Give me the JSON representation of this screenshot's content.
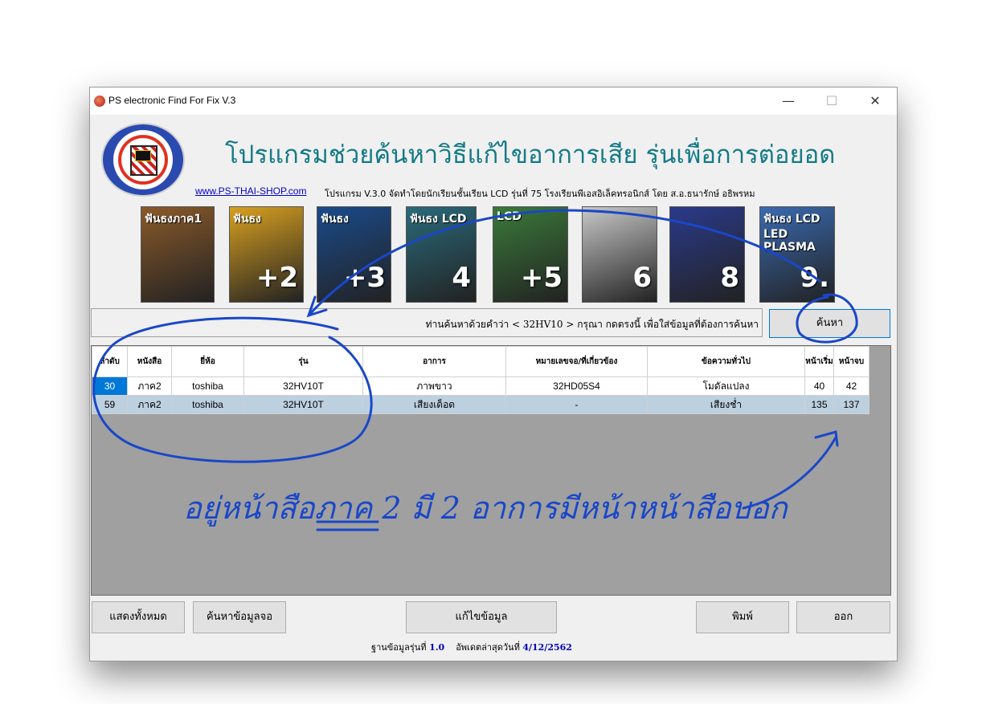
{
  "window": {
    "title": "PS electronic Find For Fix V.3",
    "minimize_glyph": "—",
    "maximize_glyph": "☐",
    "close_glyph": "✕"
  },
  "header": {
    "headline": "โปรแกรมช่วยค้นหาวิธีแก้ไขอาการเสีย รุ่นเพื่อการต่อยอด",
    "url": "www.PS-THAI-SHOP.com",
    "subtitle": "โปรแกรม V.3.0 จัดทำโดยนักเรียนชั้นเรียน LCD รุ่นที่ 75 โรงเรียนพีเอสอิเล็คทรอนิกส์ โดย ส.อ.ธนารักษ์ อธิพรหม"
  },
  "covers": [
    {
      "text": "ฟันธงภาค1",
      "num": "",
      "color": "#8a5a2a"
    },
    {
      "text": "ฟันธง",
      "num": "+2",
      "color": "#d8a020"
    },
    {
      "text": "ฟันธง",
      "num": "+3",
      "color": "#1a4a8a"
    },
    {
      "text": "ฟันธง LCD",
      "num": "4",
      "color": "#2a6a7a"
    },
    {
      "text": "LCD",
      "num": "+5",
      "color": "#3a7a3a"
    },
    {
      "text": "",
      "num": "6",
      "color": "#c8c8c8"
    },
    {
      "text": "",
      "num": "8",
      "color": "#2a3a8a"
    },
    {
      "text": "ฟันธง LCD LED PLASMA",
      "num": "9.",
      "color": "#3a6ab0"
    }
  ],
  "search": {
    "message": "ท่านค้นหาด้วยคำว่า < 32HV10 > กรุณา กดตรงนี้ เพื่อใส่ข้อมูลที่ต้องการค้นหา",
    "button_label": "ค้นหา"
  },
  "table": {
    "headers": [
      "ลำดับ",
      "หนังสือ",
      "ยี่ห้อ",
      "รุ่น",
      "อาการ",
      "หมายเลขจอ/ที่เกี่ยวข้อง",
      "ข้อความทั่วไป",
      "หน้าเริ่ม",
      "หน้าจบ"
    ],
    "rows": [
      [
        "30",
        "ภาค2",
        "toshiba",
        "32HV10T",
        "ภาพขาว",
        "32HD05S4",
        "โมดัลแปลง",
        "40",
        "42"
      ],
      [
        "59",
        "ภาค2",
        "toshiba",
        "32HV10T",
        "เสียงเด็อด",
        "-",
        "เสียงช่ำ",
        "135",
        "137"
      ]
    ]
  },
  "buttons": {
    "show_all": "แสดงทั้งหมด",
    "search_screen": "ค้นหาข้อมูลจอ",
    "edit": "แก้ไขข้อมูล",
    "print": "พิมพ์",
    "exit": "ออก"
  },
  "status": {
    "db_label": "ฐานข้อมูลรุ่นที่",
    "db_version": "1.0",
    "updated_label": "อัพเดตล่าสุดวันที่",
    "updated_date": "4/12/2562"
  },
  "annotation": {
    "handwritten_note": "อยู่หน้าสือภาค 2 มี 2 อาการมีหน้าหน้าสือบอก",
    "ink_color": "#1a47c8"
  }
}
